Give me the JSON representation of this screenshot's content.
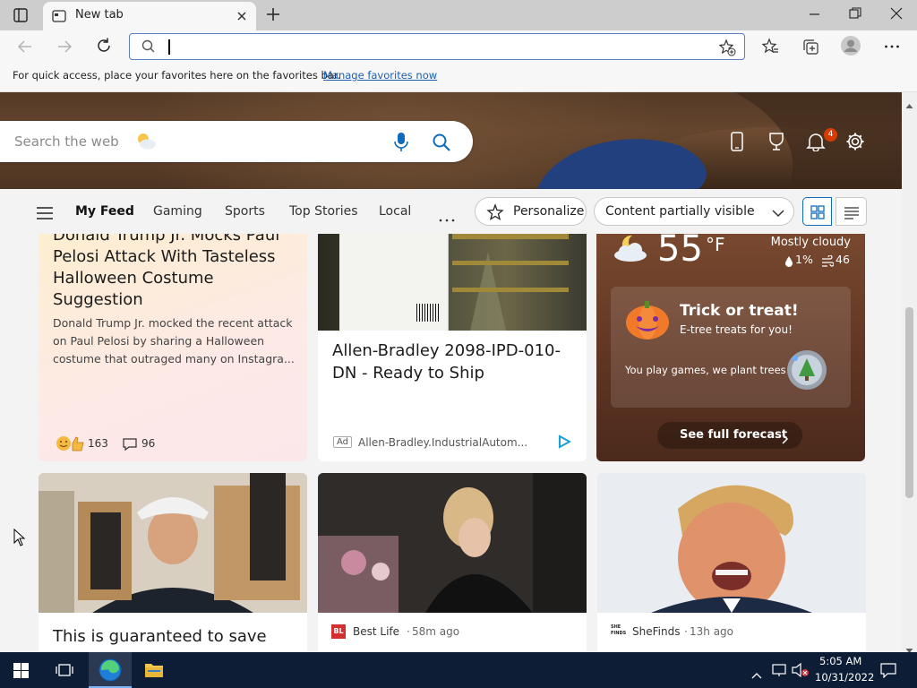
{
  "browser": {
    "tab_title": "New tab",
    "address_placeholder": "",
    "favorites_hint": "For quick access, place your favorites here on the favorites bar.",
    "favorites_link": "Manage favorites now"
  },
  "newtab": {
    "search_placeholder": "Search the web",
    "notification_count": "4",
    "nav": [
      "My Feed",
      "Gaming",
      "Sports",
      "Top Stories",
      "Local"
    ],
    "personalize": "Personalize",
    "content_select": "Content partially visible"
  },
  "cards": {
    "c1": {
      "title": "Donald Trump Jr. Mocks Paul Pelosi Attack With Tasteless Halloween Costume Suggestion",
      "summary": "Donald Trump Jr. mocked the recent attack on Paul Pelosi by sharing a Halloween costume that outraged many on Instagra...",
      "reactions": "163",
      "comments": "96"
    },
    "c2": {
      "title": "Allen-Bradley 2098-IPD-010-DN - Ready to Ship",
      "ad_label": "Ad",
      "source": "Allen-Bradley.IndustrialAutom..."
    },
    "weather": {
      "temp": "55",
      "unit": "°F",
      "condition": "Mostly cloudy",
      "precip": "1%",
      "aqi": "46",
      "promo_title": "Trick or treat!",
      "promo_sub": "E-tree treats for you!",
      "promo_body": "You play games, we plant trees",
      "forecast_btn": "See full forecast"
    },
    "c4": {
      "title": "This is guaranteed to save"
    },
    "c5": {
      "source_logo": "BL",
      "source": "Best Life",
      "time": "58m ago"
    },
    "c6": {
      "source_logo": "SHE FINDS",
      "source": "SheFinds",
      "time": "13h ago"
    }
  },
  "taskbar": {
    "time": "5:05 AM",
    "date": "10/31/2022"
  },
  "colors": {
    "accent": "#0f6cbd",
    "address_border": "#5b7ec9",
    "taskbar": "#0c1d35",
    "badge": "#d83b01",
    "weather_bg": "#6b3a24"
  }
}
